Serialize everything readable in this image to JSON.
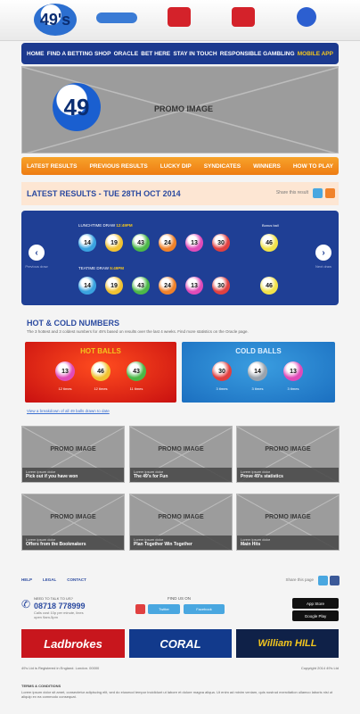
{
  "header": {
    "logo_text": "49's",
    "pill_color": "#3a7bd5",
    "badge_colors": [
      "#d4222a",
      "#d4222a",
      "#2c5fd0"
    ]
  },
  "main_nav": [
    "HOME",
    "FIND A BETTING SHOP",
    "ORACLE",
    "BET HERE",
    "STAY IN TOUCH",
    "RESPONSIBLE GAMBLING",
    "MOBILE APP"
  ],
  "hero": {
    "logo_number": "49",
    "logo_suffix": "'s",
    "label": "PROMO IMAGE"
  },
  "sub_nav": [
    "LATEST RESULTS",
    "PREVIOUS RESULTS",
    "LUCKY DIP",
    "SYNDICATES",
    "WINNERS",
    "HOW TO PLAY"
  ],
  "results": {
    "title": "LATEST RESULTS - TUE 28TH OCT 2014",
    "share_text": "Share this result",
    "lunchtime": {
      "label": "LUNCHTIME DRAW",
      "time": "12:49PM",
      "balls": [
        "14",
        "19",
        "43",
        "24",
        "13",
        "30"
      ],
      "bonus": "46"
    },
    "teatime": {
      "label": "TEATIME DRAW",
      "time": "5:49PM",
      "balls": [
        "14",
        "19",
        "43",
        "24",
        "13",
        "30"
      ],
      "bonus": "46"
    },
    "bonus_caption": "Bonus ball",
    "prev_caption": "Previous draw",
    "next_caption": "Next draw",
    "ball_colors": [
      "#3aa3e0",
      "#f1c232",
      "#4cb848",
      "#f0822a",
      "#e04bb8",
      "#e04040"
    ],
    "bonus_color": "#f1e24a"
  },
  "hot_cold": {
    "title": "HOT & COLD NUMBERS",
    "description": "The 3 hottest and 3 coldest numbers for 49's based on results over the last 4 weeks. Find more statistics on the Oracle page.",
    "hot": {
      "title": "HOT BALLS",
      "balls": [
        "13",
        "46",
        "43"
      ],
      "captions": [
        "12 times",
        "12 times",
        "11 times"
      ]
    },
    "cold": {
      "title": "COLD BALLS",
      "balls": [
        "30",
        "14",
        "13"
      ],
      "captions": [
        "3 times",
        "3 times",
        "3 times"
      ]
    },
    "hot_colors": [
      "#e04bb8",
      "#f1c232",
      "#4cb848"
    ],
    "cold_colors": [
      "#e04040",
      "#9aa3ad",
      "#e04bb8"
    ],
    "breakdown_link": "View a breakdown of all 49 balls drawn to date"
  },
  "promos": [
    {
      "label": "PROMO IMAGE",
      "tag": "Lorem ipsum dolor",
      "title": "Pick out if you have won"
    },
    {
      "label": "PROMO IMAGE",
      "tag": "Lorem ipsum dolor",
      "title": "The 49's for Fun"
    },
    {
      "label": "PROMO IMAGE",
      "tag": "Lorem ipsum dolor",
      "title": "Prove 49's statistics"
    },
    {
      "label": "PROMO IMAGE",
      "tag": "Lorem ipsum dolor",
      "title": "Offers from the Bookmakers"
    },
    {
      "label": "PROMO IMAGE",
      "tag": "Lorem ipsum dolor",
      "title": "Plan Together Win Together"
    },
    {
      "label": "PROMO IMAGE",
      "tag": "Lorem ipsum dolor",
      "title": "Main Hits"
    }
  ],
  "footer": {
    "links": [
      "HELP",
      "LEGAL",
      "CONTACT"
    ],
    "share_text": "Share this page",
    "phone_small": "NEED TO TALK TO US?",
    "phone_number": "08718 778999",
    "phone_sub": "Calls cost 10p per minute, lines open 9am-5pm",
    "follow": "FIND US ON",
    "twitter_label": "Twitter",
    "facebook_label": "Facebook",
    "app_store": "App Store",
    "google_play": "Google Play",
    "bookmakers": [
      {
        "name": "Ladbrokes",
        "bg": "#c8161d",
        "fg": "#ffffff"
      },
      {
        "name": "CORAL",
        "bg": "#123a8c",
        "fg": "#ffffff"
      },
      {
        "name": "William HILL",
        "bg": "#0f2148",
        "fg": "#f3c61e"
      }
    ],
    "legal_left": "49's Ltd is Registered in England. London. 00000",
    "legal_right": "Copyright 2014 49's Ltd",
    "legal_title": "TERMS & CONDITIONS",
    "legal_body": "Lorem ipsum dolor sit amet, consectetur adipiscing elit, sed do eiusmod tempor incididunt ut labore et dolore magna aliqua. Ut enim ad minim veniam, quis nostrud exercitation ullamco laboris nisi ut aliquip ex ea commodo consequat."
  }
}
